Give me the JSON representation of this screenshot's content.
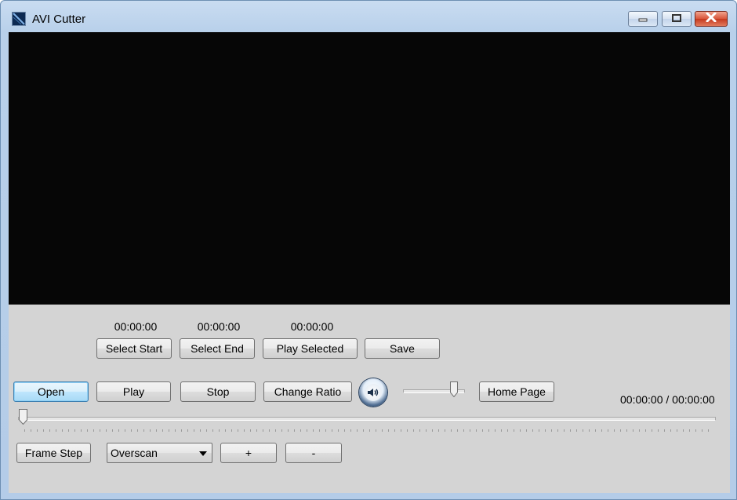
{
  "window": {
    "title": "AVI Cutter"
  },
  "selection": {
    "start_time": "00:00:00",
    "end_time": "00:00:00",
    "selected_time": "00:00:00",
    "select_start_label": "Select Start",
    "select_end_label": "Select End",
    "play_selected_label": "Play Selected",
    "save_label": "Save"
  },
  "controls": {
    "open_label": "Open",
    "play_label": "Play",
    "stop_label": "Stop",
    "change_ratio_label": "Change Ratio",
    "home_page_label": "Home Page",
    "time_readout": "00:00:00 / 00:00:00",
    "volume_level_pct": 90,
    "seek_position_pct": 0
  },
  "bottom": {
    "frame_step_label": "Frame Step",
    "scan_mode": "Overscan",
    "plus_label": "+",
    "minus_label": "-"
  },
  "icons": {
    "app": "avi-cutter-app-icon",
    "mute": "speaker-icon"
  }
}
